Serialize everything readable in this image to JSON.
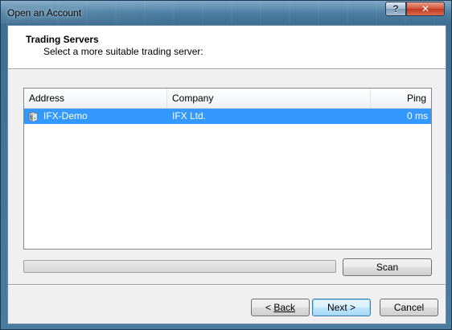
{
  "window": {
    "title": "Open an Account",
    "help_label": "?",
    "close_label": "✕"
  },
  "header": {
    "title": "Trading Servers",
    "subtitle": "Select a more suitable trading server:"
  },
  "table": {
    "columns": [
      "Address",
      "Company",
      "Ping"
    ],
    "rows": [
      {
        "address": "IFX-Demo",
        "company": "IFX Ltd.",
        "ping": "0 ms",
        "selected": true,
        "icon": "server-icon"
      }
    ]
  },
  "progress": {
    "value": 0
  },
  "buttons": {
    "scan_label": "Scan",
    "back_label": "Back",
    "next_label": "Next >",
    "cancel_label": "Cancel"
  },
  "colors": {
    "selection": "#3399ff",
    "title_bar": "#4c7ea2",
    "close_button": "#c13a20"
  }
}
